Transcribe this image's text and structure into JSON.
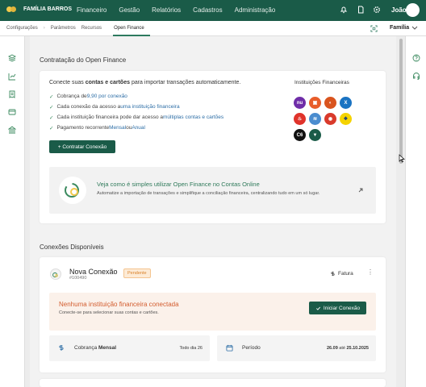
{
  "header": {
    "brand": "FAMÍLIA BARROS",
    "nav": [
      "Financeiro",
      "Gestão",
      "Relatórios",
      "Cadastros",
      "Administração"
    ],
    "user": "João"
  },
  "subnav": {
    "crumbs": [
      "Configurações",
      "Parâmetros",
      "Recursos"
    ],
    "active_tab": "Open Finance",
    "profile": "Família"
  },
  "contract": {
    "title": "Contratação do Open Finance",
    "intro_prefix": "Conecte suas ",
    "intro_bold": "contas e cartões",
    "intro_suffix": " para importar transações automaticamente.",
    "features": [
      {
        "text": "Cobrança de ",
        "link": "9,90 por conexão",
        "tail": ""
      },
      {
        "text": "Cada conexão da acesso a ",
        "link": "uma instituição financeira",
        "tail": ""
      },
      {
        "text": "Cada instituição financeira pode dar acesso a ",
        "link": "múltiplas contas e cartões",
        "tail": ""
      },
      {
        "text": "Pagamento recorrente ",
        "link": "Mensal",
        "mid": " ou ",
        "link2": "Anual"
      }
    ],
    "button": "+ Contratar Conexão",
    "institutions_title": "Instituições Financeiras",
    "promo_title": "Veja como é simples utilizar Open Finance no Contas Online",
    "promo_sub": "Automatize a importação de transações e simplifique a conciliação financeira, centralizando tudo em um só lugar."
  },
  "connections": {
    "title": "Conexões Disponíveis",
    "name": "Nova Conexão",
    "id": "#100490",
    "status": "Pendente",
    "invoice": "Fatura",
    "empty_title": "Nenhuma instituição financeira conectada",
    "empty_sub": "Conecte-se para selecionar suas contas e cartões.",
    "connect_button": "Iniciar Conexão",
    "billing_label": "Cobrança",
    "billing_type": "Mensal",
    "billing_value": "Todo dia 26",
    "period_label": "Período",
    "period_start": "26.09",
    "period_sep": "até",
    "period_end": "25.10.2025"
  },
  "colors": {
    "primary": "#1a5b48",
    "accent": "#d35d2f",
    "link": "#2d6ea6",
    "check": "#3b8a5f"
  }
}
